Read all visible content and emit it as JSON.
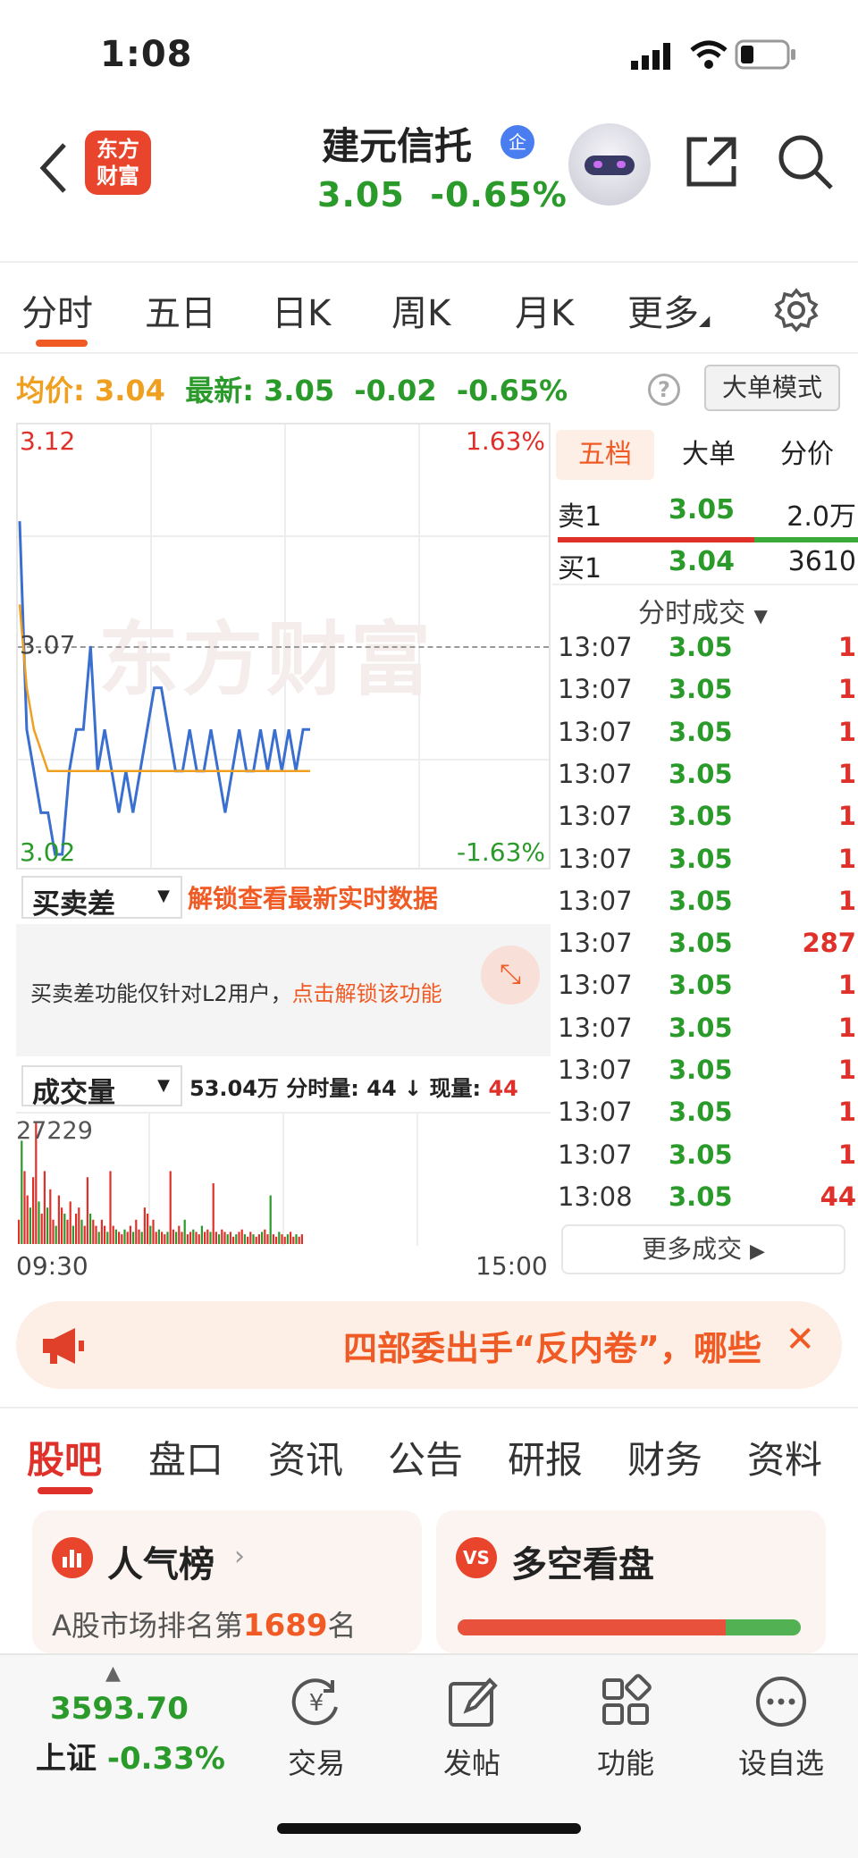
{
  "status_bar": {
    "time": "1:08"
  },
  "header": {
    "logo_line1": "东方",
    "logo_line2": "财富",
    "stock_name": "建元信托",
    "badge": "企",
    "price": "3.05",
    "change_pct": "-0.65%"
  },
  "chart_tabs": [
    "分时",
    "五日",
    "日K",
    "周K",
    "月K",
    "更多"
  ],
  "summary": {
    "avg_label": "均价:",
    "avg_value": "3.04",
    "latest_label": "最新:",
    "latest_value": "3.05",
    "change": "-0.02",
    "change_pct": "-0.65%",
    "mode_button": "大单模式"
  },
  "intraday": {
    "y_max": "3.12",
    "y_mid": "3.07",
    "y_min": "3.02",
    "pct_max": "1.63%",
    "pct_min": "-1.63%",
    "watermark": "东方财富"
  },
  "chart_data": {
    "type": "line",
    "ylim": [
      3.02,
      3.12
    ],
    "prev_close": 3.07,
    "series": [
      {
        "values": [
          3.1,
          3.05,
          3.04,
          3.03,
          3.03,
          3.02,
          3.02,
          3.04,
          3.05,
          3.05,
          3.07,
          3.04,
          3.05,
          3.04,
          3.03,
          3.04,
          3.03,
          3.04,
          3.05,
          3.06,
          3.06,
          3.05,
          3.04,
          3.04,
          3.05,
          3.04,
          3.04,
          3.05,
          3.04,
          3.03,
          3.04,
          3.05,
          3.04,
          3.04,
          3.05,
          3.04,
          3.05,
          3.04,
          3.05,
          3.04,
          3.05,
          3.05
        ]
      },
      {
        "values": [
          3.08,
          3.06,
          3.05,
          3.045,
          3.04,
          3.04,
          3.04,
          3.04,
          3.04,
          3.04,
          3.04,
          3.04,
          3.04,
          3.04,
          3.04,
          3.04,
          3.04,
          3.04,
          3.04,
          3.04,
          3.04,
          3.04,
          3.04,
          3.04,
          3.04,
          3.04,
          3.04,
          3.04,
          3.04,
          3.04,
          3.04,
          3.04,
          3.04,
          3.04,
          3.04,
          3.04,
          3.04,
          3.04,
          3.04,
          3.04,
          3.04,
          3.04
        ]
      }
    ]
  },
  "orderbook": {
    "tabs": [
      "五档",
      "大单",
      "分价"
    ],
    "sell1": {
      "label": "卖1",
      "price": "3.05",
      "vol": "2.0万"
    },
    "buy1": {
      "label": "买1",
      "price": "3.04",
      "vol": "3610"
    },
    "trades_header": "分时成交",
    "trades": [
      {
        "t": "13:07",
        "p": "3.05",
        "v": "1"
      },
      {
        "t": "13:07",
        "p": "3.05",
        "v": "1"
      },
      {
        "t": "13:07",
        "p": "3.05",
        "v": "1"
      },
      {
        "t": "13:07",
        "p": "3.05",
        "v": "1"
      },
      {
        "t": "13:07",
        "p": "3.05",
        "v": "1"
      },
      {
        "t": "13:07",
        "p": "3.05",
        "v": "1"
      },
      {
        "t": "13:07",
        "p": "3.05",
        "v": "1"
      },
      {
        "t": "13:07",
        "p": "3.05",
        "v": "287"
      },
      {
        "t": "13:07",
        "p": "3.05",
        "v": "1"
      },
      {
        "t": "13:07",
        "p": "3.05",
        "v": "1"
      },
      {
        "t": "13:07",
        "p": "3.05",
        "v": "1"
      },
      {
        "t": "13:07",
        "p": "3.05",
        "v": "1"
      },
      {
        "t": "13:07",
        "p": "3.05",
        "v": "1"
      },
      {
        "t": "13:08",
        "p": "3.05",
        "v": "44"
      }
    ],
    "more_trades": "更多成交"
  },
  "l2": {
    "selector": "买卖差",
    "unlock_text": "解锁查看最新实时数据",
    "notice": "买卖差功能仅针对L2用户，",
    "notice_link": "点击解锁该功能"
  },
  "volume": {
    "selector": "成交量",
    "total": "53.04万",
    "fen_label": "分时量:",
    "fen_value": "44",
    "xian_label": "现量:",
    "xian_value": "44",
    "max": "27229",
    "values": [
      20,
      85,
      60,
      40,
      30,
      55,
      100,
      35,
      25,
      60,
      30,
      45,
      20,
      15,
      40,
      30,
      25,
      20,
      35,
      15,
      25,
      30,
      20,
      15,
      55,
      25,
      20,
      15,
      10,
      20,
      15,
      10,
      60,
      15,
      12,
      10,
      8,
      12,
      10,
      15,
      10,
      20,
      12,
      10,
      30,
      25,
      15,
      20,
      10,
      12,
      10,
      8,
      10,
      60,
      12,
      10,
      15,
      10,
      20,
      8,
      10,
      12,
      10,
      8,
      15,
      10,
      12,
      10,
      50,
      10,
      8,
      12,
      10,
      8,
      10,
      6,
      8,
      10,
      12,
      8,
      6,
      10,
      8,
      6,
      8,
      10,
      12,
      8,
      40,
      8,
      6,
      10,
      8,
      6,
      8,
      10,
      6,
      8,
      6,
      8
    ],
    "start": "09:30",
    "end": "15:00"
  },
  "banner": {
    "text": "四部委出手“反内卷”，哪些"
  },
  "section_tabs": [
    "股吧",
    "盘口",
    "资讯",
    "公告",
    "研报",
    "财务",
    "资料"
  ],
  "cards": {
    "popularity_title": "人气榜",
    "popularity_sub_prefix": "A股市场排名第",
    "popularity_rank": "1689",
    "popularity_sub_suffix": "名",
    "longshort_title": "多空看盘",
    "long_ratio": 0.78
  },
  "bottom_nav": {
    "index_value": "3593.70",
    "index_name": "上证",
    "index_change": "-0.33%",
    "items": [
      "交易",
      "发帖",
      "功能",
      "设自选"
    ]
  },
  "colors": {
    "up": "#e0302a",
    "down": "#2a9a2a",
    "accent": "#f05a24",
    "avg": "#f0a020",
    "line": "#3a6fd0"
  }
}
